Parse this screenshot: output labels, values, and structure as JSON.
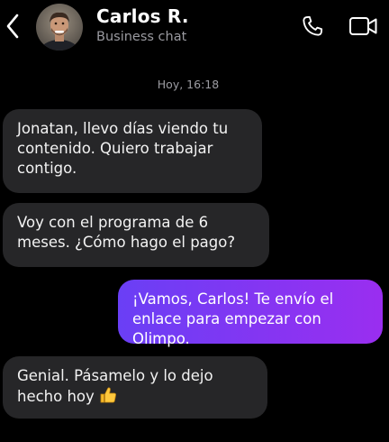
{
  "header": {
    "contact_name": "Carlos R.",
    "contact_subtitle": "Business chat",
    "back_icon": "chevron-left-icon",
    "call_icon": "phone-icon",
    "video_icon": "video-camera-icon"
  },
  "chat": {
    "timestamp": "Hoy, 16:18",
    "messages": [
      {
        "direction": "incoming",
        "text": "Jonatan, llevo días viendo tu contenido. Quiero trabajar contigo."
      },
      {
        "direction": "incoming",
        "text": "Voy con el programa de 6 meses. ¿Cómo hago el pago?"
      },
      {
        "direction": "outgoing",
        "text": "¡Vamos, Carlos! Te envío el enlace para empezar con Olimpo."
      },
      {
        "direction": "incoming",
        "text": "Genial. Pásamelo y lo dejo hecho hoy",
        "emoji": "thumbs-up-icon"
      }
    ]
  },
  "colors": {
    "background": "#000000",
    "incoming_bubble": "#262628",
    "outgoing_gradient_start": "#6a3ff5",
    "outgoing_gradient_end": "#9a2ef0",
    "subtitle_text": "#9a9aa0"
  }
}
